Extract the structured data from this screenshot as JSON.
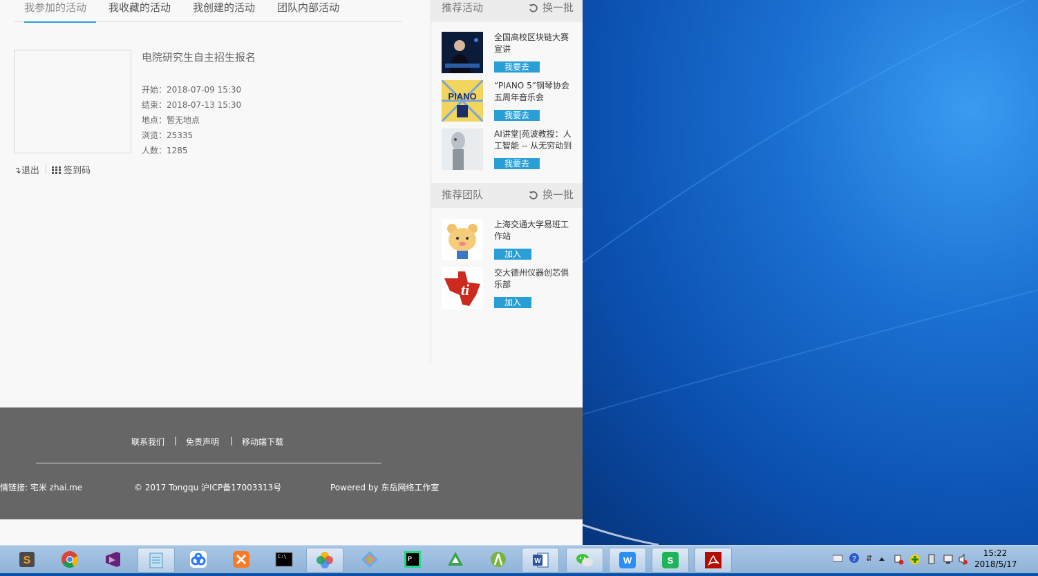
{
  "tabs": [
    {
      "label": "我参加的活动",
      "active": true
    },
    {
      "label": "我收藏的活动"
    },
    {
      "label": "我创建的活动"
    },
    {
      "label": "团队内部活动"
    }
  ],
  "event": {
    "title": "电院研究生自主招生报名",
    "start": "开始：2018-07-09 15:30",
    "end": "结束：2018-07-13 15:30",
    "location": "地点：暂无地点",
    "views": "浏览：25335",
    "people": "人数：1285",
    "exit_label": "退出",
    "qrcode_label": "签到码"
  },
  "sidebar": {
    "rec_activities_title": "推荐活动",
    "rec_teams_title": "推荐团队",
    "refresh_label": "换一批",
    "activities": [
      {
        "title": "全国高校区块链大赛宣讲",
        "button": "我要去"
      },
      {
        "title": "“PIANO 5”钢琴协会五周年音乐会",
        "button": "我要去"
      },
      {
        "title": "AI讲堂|苑波教授：人工智能 -- 从无穷动到",
        "button": "我要去"
      }
    ],
    "teams": [
      {
        "title": "上海交通大学易班工作站",
        "button": "加入"
      },
      {
        "title": "交大德州仪器创芯俱乐部",
        "button": "加入"
      }
    ],
    "piano_art_text": "PIANO"
  },
  "footer": {
    "contact": "联系我们",
    "disclaimer": "免责声明",
    "mobile": "移动端下载",
    "sep": "|",
    "friend_link": "友情链接: 宅米 zhai.me",
    "copyright": "© 2017 Tongqu 沪ICP备17003313号",
    "powered": "Powered by 东岳网络工作室"
  },
  "taskbar": {
    "apps": [
      "sublime-text",
      "chrome",
      "visual-studio",
      "notepad",
      "baidu-netdisk",
      "xampp",
      "command-prompt",
      "photos",
      "sourcetree",
      "pycharm",
      "onenote",
      "android-studio",
      "word",
      "wechat",
      "wps",
      "wps-spreadsheet",
      "acrobat"
    ],
    "time": "15:22",
    "date": "2018/5/17"
  },
  "colors": {
    "accent": "#2a9fd6",
    "footer_bg": "#666666",
    "desktop": "#0b4fae"
  }
}
